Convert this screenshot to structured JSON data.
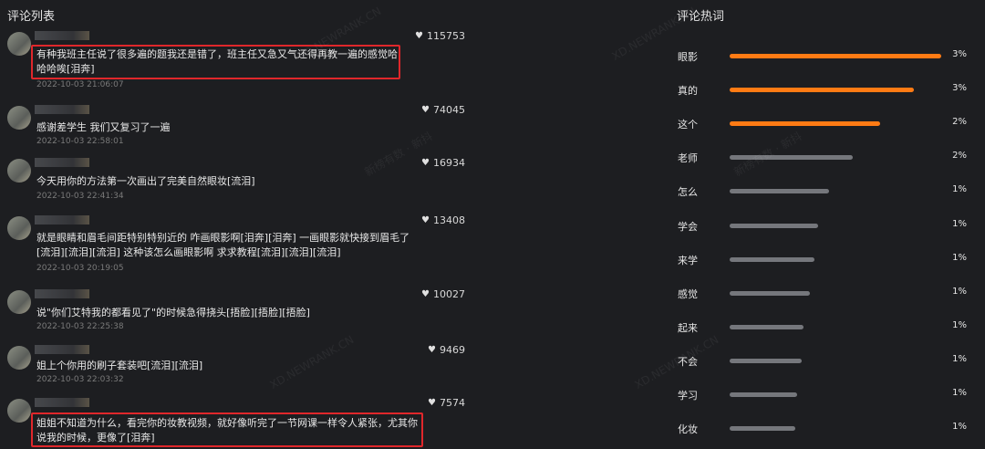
{
  "comments_panel": {
    "title": "评论列表",
    "items": [
      {
        "text": "有种我班主任说了很多遍的题我还是错了，班主任又急又气还得再教一遍的感觉哈哈哈唉[泪奔]",
        "time": "2022-10-03 21:06:07",
        "likes": "115753"
      },
      {
        "text": "感谢差学生 我们又复习了一遍",
        "time": "2022-10-03 22:58:01",
        "likes": "74045"
      },
      {
        "text": "今天用你的方法第一次画出了完美自然眼妆[流泪]",
        "time": "2022-10-03 22:41:34",
        "likes": "16934"
      },
      {
        "text": "就是眼睛和眉毛间距特别特别近的 咋画眼影啊[泪奔][泪奔] 一画眼影就快接到眉毛了[流泪][流泪][流泪] 这种该怎么画眼影啊 求求教程[流泪][流泪][流泪]",
        "time": "2022-10-03 20:19:05",
        "likes": "13408"
      },
      {
        "text": "说\"你们艾特我的都看见了\"的时候急得挠头[捂脸][捂脸][捂脸]",
        "time": "2022-10-03 22:25:38",
        "likes": "10027"
      },
      {
        "text": "姐上个你用的刷子套装吧[流泪][流泪]",
        "time": "2022-10-03 22:03:32",
        "likes": "9469"
      },
      {
        "text": "姐姐不知道为什么，看完你的妆教视频，就好像听完了一节网课一样令人紧张，尤其你说我的时候，更像了[泪奔]",
        "time": "",
        "likes": "7574"
      }
    ]
  },
  "hot_words_panel": {
    "title": "评论热词",
    "items": [
      {
        "word": "眼影",
        "pct": "3%",
        "level": 1.0,
        "accent": true
      },
      {
        "word": "真的",
        "pct": "3%",
        "level": 0.87,
        "accent": true
      },
      {
        "word": "这个",
        "pct": "2%",
        "level": 0.71,
        "accent": true
      },
      {
        "word": "老师",
        "pct": "2%",
        "level": 0.58,
        "accent": false
      },
      {
        "word": "怎么",
        "pct": "1%",
        "level": 0.47,
        "accent": false
      },
      {
        "word": "学会",
        "pct": "1%",
        "level": 0.42,
        "accent": false
      },
      {
        "word": "来学",
        "pct": "1%",
        "level": 0.4,
        "accent": false
      },
      {
        "word": "感觉",
        "pct": "1%",
        "level": 0.38,
        "accent": false
      },
      {
        "word": "起来",
        "pct": "1%",
        "level": 0.35,
        "accent": false
      },
      {
        "word": "不会",
        "pct": "1%",
        "level": 0.34,
        "accent": false
      },
      {
        "word": "学习",
        "pct": "1%",
        "level": 0.32,
        "accent": false
      },
      {
        "word": "化妆",
        "pct": "1%",
        "level": 0.31,
        "accent": false
      }
    ]
  },
  "colors": {
    "accent": "#ff7b14",
    "highlight": "#e0272b",
    "bar_gray": "#75777c"
  },
  "icons": {
    "like": "heart-icon"
  },
  "watermark": {
    "text_a": "XD.NEWRANK.CN",
    "text_b": "新榜有数 · 新抖"
  }
}
